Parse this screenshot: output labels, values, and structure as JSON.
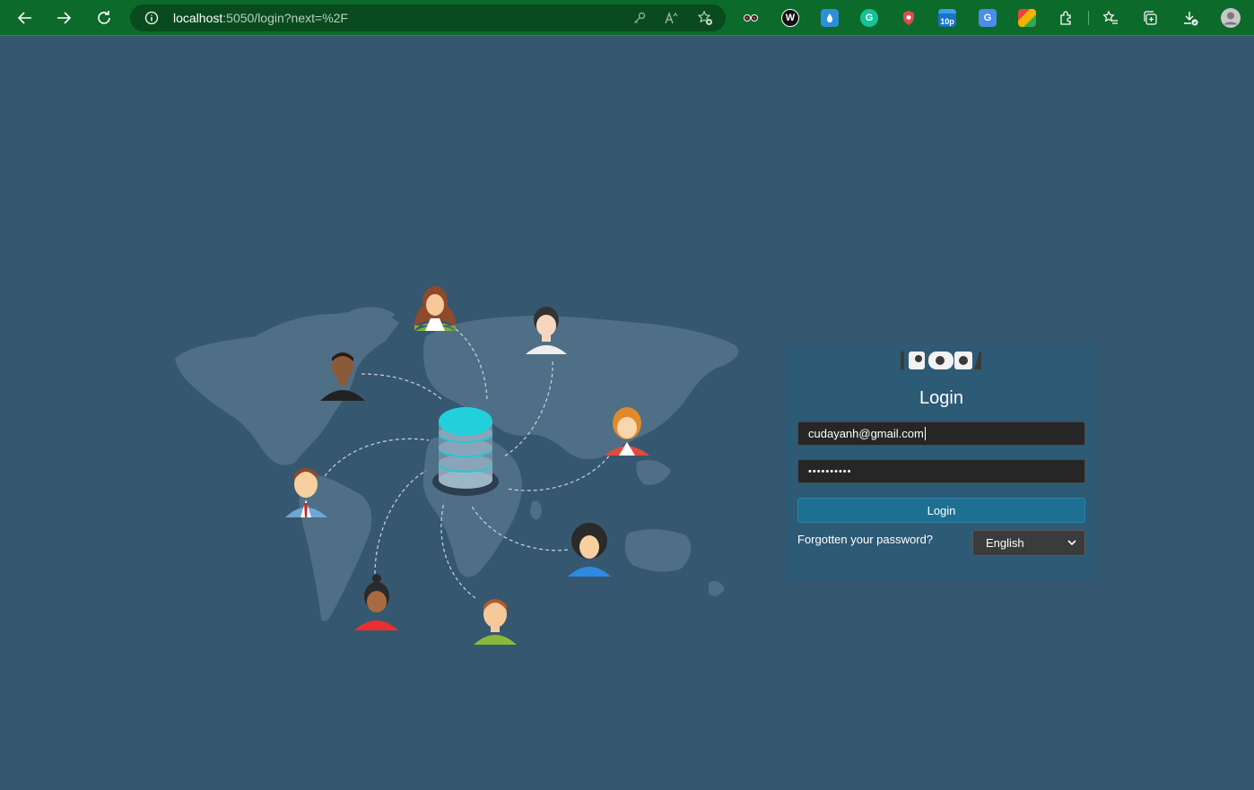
{
  "browser": {
    "url_host": "localhost",
    "url_rest": ":5050/login?next=%2F",
    "extensions": [
      {
        "name": "glasses-extension-icon",
        "color": "#0c6a2a",
        "glyph": ""
      },
      {
        "name": "w-extension-icon",
        "color": "#111111",
        "glyph": "W"
      },
      {
        "name": "droplet-extension-icon",
        "color": "#2d8fd8",
        "glyph": ""
      },
      {
        "name": "grammarly-extension-icon",
        "color": "#15c39a",
        "glyph": "G"
      },
      {
        "name": "shield-extension-icon",
        "color": "#e04b4b",
        "glyph": ""
      },
      {
        "name": "10p-extension-icon",
        "color": "#1a73c9",
        "glyph": "10p"
      },
      {
        "name": "translate-extension-icon",
        "color": "#4d8be8",
        "glyph": "G"
      },
      {
        "name": "color-picker-extension-icon",
        "color": "#f0b400",
        "glyph": ""
      }
    ]
  },
  "login": {
    "title": "Login",
    "email_value": "cudayanh@gmail.com",
    "password_mask": "••••••••••",
    "submit_label": "Login",
    "forgot_label": "Forgotten your password?",
    "language_selected": "English"
  },
  "colors": {
    "page_bg": "#365770",
    "panel_bg": "#2d5a75",
    "button_bg": "#1e7092",
    "toolbar_bg": "#0c6a2a"
  }
}
